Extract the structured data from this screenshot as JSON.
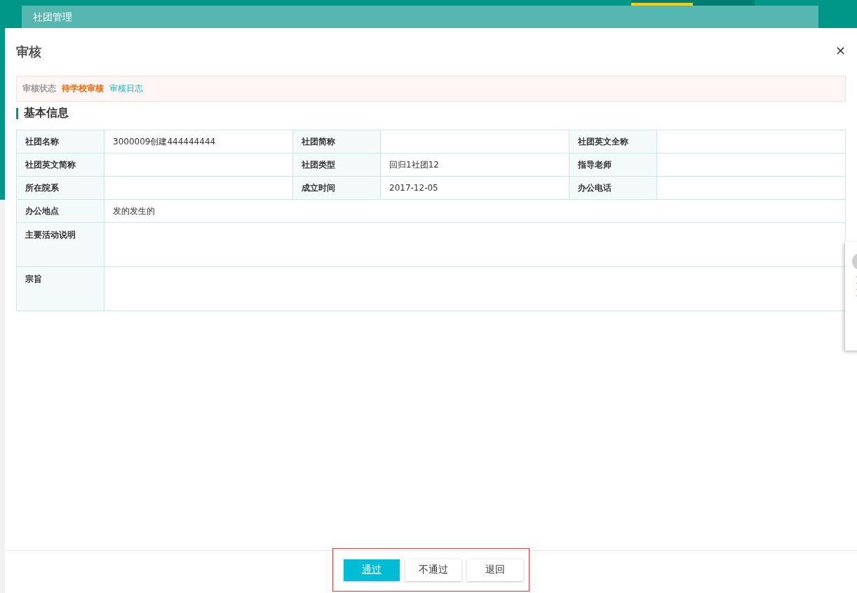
{
  "page_tab": {
    "label": "社团管理"
  },
  "dialog": {
    "title": "审核",
    "close": "×"
  },
  "status": {
    "label": "审核状态",
    "value": "待学校审核",
    "log_link": "审核日志"
  },
  "section": {
    "title": "基本信息"
  },
  "table": {
    "rows": [
      {
        "kind": "short",
        "fields": [
          {
            "label": "社团名称",
            "value": "3000009创建444444444"
          },
          {
            "label": "社团简称"
          },
          {
            "label": "社团英文全称"
          }
        ]
      },
      {
        "kind": "short",
        "fields": [
          {
            "label": "社团英文简称"
          },
          {
            "label": "社团类型",
            "value": "回归1社团12"
          },
          {
            "label": "指导老师"
          }
        ]
      },
      {
        "kind": "short",
        "fields": [
          {
            "label": "所在院系"
          },
          {
            "label": "成立时间",
            "value": "2017-12-05"
          },
          {
            "label": "办公电话"
          }
        ]
      },
      {
        "kind": "short",
        "fields": [
          {
            "label": "办公地点",
            "value": "发的发生的"
          }
        ]
      },
      {
        "kind": "tall",
        "fields": [
          {
            "label": "主要活动说明"
          }
        ]
      },
      {
        "kind": "tall",
        "fields": [
          {
            "label": "宗旨"
          }
        ]
      }
    ]
  },
  "buttons": [
    {
      "label": "通过",
      "kind": "primary"
    },
    {
      "label": "不通过",
      "kind": "default"
    },
    {
      "label": "退回",
      "kind": "default"
    }
  ]
}
